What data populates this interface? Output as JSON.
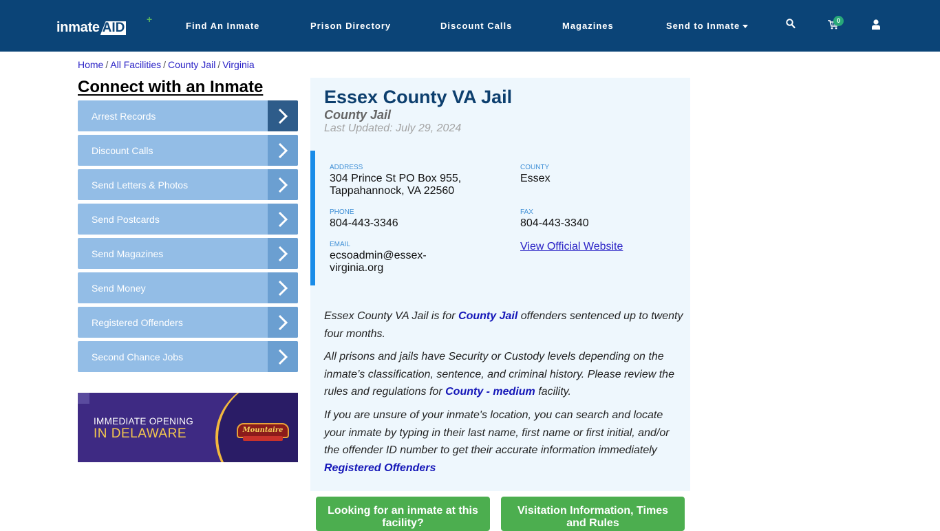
{
  "navbar": {
    "logo": {
      "part1": "inmate",
      "part2": "AID",
      "plus": "+"
    },
    "links": [
      {
        "label": "Find An Inmate"
      },
      {
        "label": "Prison Directory"
      },
      {
        "label": "Discount Calls"
      },
      {
        "label": "Magazines"
      },
      {
        "label": "Send to Inmate",
        "has_dropdown": true
      }
    ],
    "icons": {
      "search": "search-icon",
      "cart": "cart-icon",
      "user": "user-icon"
    },
    "cart_count": "0"
  },
  "breadcrumb": [
    {
      "label": "Home"
    },
    {
      "label": "All Facilities"
    },
    {
      "label": "County Jail"
    },
    {
      "label": "Virginia"
    }
  ],
  "breadcrumb_separator": "/",
  "sidebar": {
    "title": "Connect with an Inmate",
    "items": [
      {
        "label": "Arrest Records",
        "active": true
      },
      {
        "label": "Discount Calls"
      },
      {
        "label": "Send Letters & Photos"
      },
      {
        "label": "Send Postcards"
      },
      {
        "label": "Send Magazines"
      },
      {
        "label": "Send Money"
      },
      {
        "label": "Registered Offenders"
      },
      {
        "label": "Second Chance Jobs"
      }
    ],
    "ad": {
      "line1": "IMMEDIATE OPENING",
      "line2": "IN DELAWARE",
      "brand": "Mountaire"
    }
  },
  "facility": {
    "name": "Essex County VA Jail",
    "type": "County Jail",
    "last_updated": "Last Updated: July 29, 2024",
    "address_label": "ADDRESS",
    "address_line1": "304 Prince St PO Box 955,",
    "address_line2": "Tappahannock, VA 22560",
    "county_label": "COUNTY",
    "county": "Essex",
    "phone_label": "PHONE",
    "phone": "804-443-3346",
    "fax_label": "FAX",
    "fax": "804-443-3340",
    "email_label": "EMAIL",
    "email_line1": "ecsoadmin@essex-",
    "email_line2": "virginia.org",
    "website_link": "View Official Website"
  },
  "description": {
    "p1_before": "Essex County VA Jail is for ",
    "p1_link": "County Jail",
    "p1_after": " offenders sentenced up to twenty four months.",
    "p2_before": "All prisons and jails have Security or Custody levels depending on the inmate’s classification, sentence, and criminal history. Please review the rules and regulations for ",
    "p2_link": "County - medium",
    "p2_after": " facility.",
    "p3_text": "If you are unsure of your inmate's location, you can search and locate your inmate by typing in their last name, first name or first initial, and/or the offender ID number to get their accurate information immediately ",
    "p3_link": "Registered Offenders"
  },
  "buttons": {
    "inmate_search": "Looking for an inmate at this facility?",
    "visitation": "Visitation Information, Times and Rules"
  },
  "colors": {
    "navbar": "#0b4477",
    "sidebar_item": "#93bde6",
    "sidebar_arrow": "#6b9fd1",
    "sidebar_arrow_active": "#2e5c8a",
    "card_bg": "#eef7fd",
    "accent_border": "#1a8ce8",
    "button_green": "#4cae4f",
    "link": "#1416b8"
  }
}
